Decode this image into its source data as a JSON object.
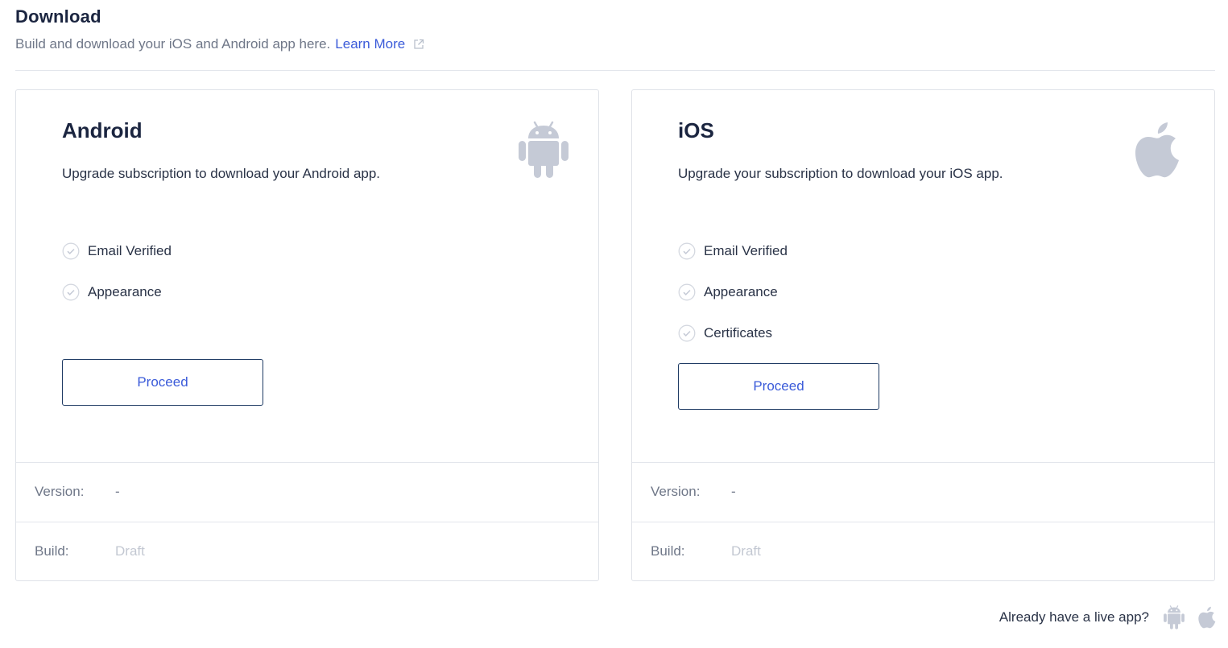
{
  "header": {
    "title": "Download",
    "subtitle": "Build and download your iOS and Android app here.",
    "learn_more": "Learn More",
    "external_icon": "external-link-icon"
  },
  "cards": {
    "android": {
      "title": "Android",
      "description": "Upgrade subscription to download your Android app.",
      "icon": "android-icon",
      "checklist": [
        "Email Verified",
        "Appearance"
      ],
      "button": "Proceed",
      "version_label": "Version:",
      "version_value": "-",
      "build_label": "Build:",
      "build_value": "Draft"
    },
    "ios": {
      "title": "iOS",
      "description": "Upgrade your subscription to download your iOS app.",
      "icon": "apple-icon",
      "checklist": [
        "Email Verified",
        "Appearance",
        "Certificates"
      ],
      "button": "Proceed",
      "version_label": "Version:",
      "version_value": "-",
      "build_label": "Build:",
      "build_value": "Draft"
    }
  },
  "footer": {
    "text": "Already have a live app?",
    "icons": [
      "android-icon",
      "apple-icon"
    ]
  },
  "colors": {
    "accent": "#3b5bd9",
    "title": "#1b2540",
    "muted": "#6f7788",
    "icon": "#c5cad6",
    "button_border": "#1e3a63"
  }
}
